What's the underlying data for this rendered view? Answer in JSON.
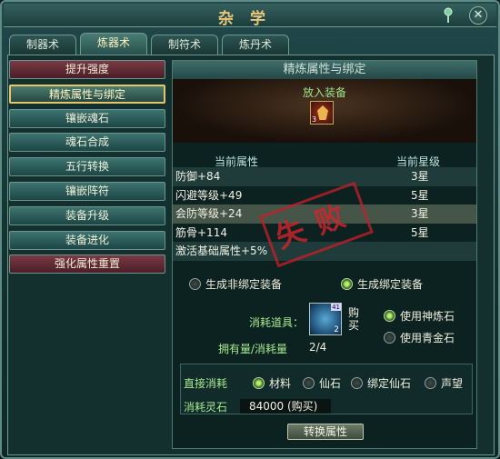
{
  "window": {
    "title": "杂学"
  },
  "tabs": [
    {
      "label": "制器术"
    },
    {
      "label": "炼器术"
    },
    {
      "label": "制符术"
    },
    {
      "label": "炼丹术"
    }
  ],
  "sidebar": {
    "items": [
      {
        "label": "提升强度"
      },
      {
        "label": "精炼属性与绑定"
      },
      {
        "label": "镶嵌魂石"
      },
      {
        "label": "魂石合成"
      },
      {
        "label": "五行转换"
      },
      {
        "label": "镶嵌阵符"
      },
      {
        "label": "装备升级"
      },
      {
        "label": "装备进化"
      },
      {
        "label": "强化属性重置"
      }
    ]
  },
  "main": {
    "header": "精炼属性与绑定",
    "equip_label": "放入装备",
    "equip_qty": "3",
    "attr_header_name": "当前属性",
    "attr_header_star": "当前星级",
    "attributes": [
      {
        "name": "防御+84",
        "star": "3星"
      },
      {
        "name": "闪避等级+49",
        "star": "5星"
      },
      {
        "name": "会防等级+24",
        "star": "3星"
      },
      {
        "name": "筋骨+114",
        "star": "5星"
      },
      {
        "name": "激活基础属性+5%",
        "star": ""
      }
    ],
    "stamp_text": "失败",
    "bind_options": {
      "unbound": "生成非绑定装备",
      "bound": "生成绑定装备"
    },
    "consume_label": "消耗道具：",
    "item_qty": "2",
    "item_tag": "41",
    "buy_label": "购买",
    "owned_label": "拥有量/消耗量",
    "owned_value": "2/4",
    "stone_options": {
      "shenlian": "使用神炼石",
      "qingjin": "使用青金石"
    },
    "direct_consume_label": "直接消耗",
    "direct_options": [
      "材料",
      "仙石",
      "绑定仙石",
      "声望"
    ],
    "cost_label": "消耗灵石",
    "cost_value": "84000 (购买)",
    "convert_button": "转换属性"
  },
  "colors": {
    "accent_gold": "#e3c768",
    "label_green": "#a8e88f",
    "stamp_red": "#d2232d"
  }
}
